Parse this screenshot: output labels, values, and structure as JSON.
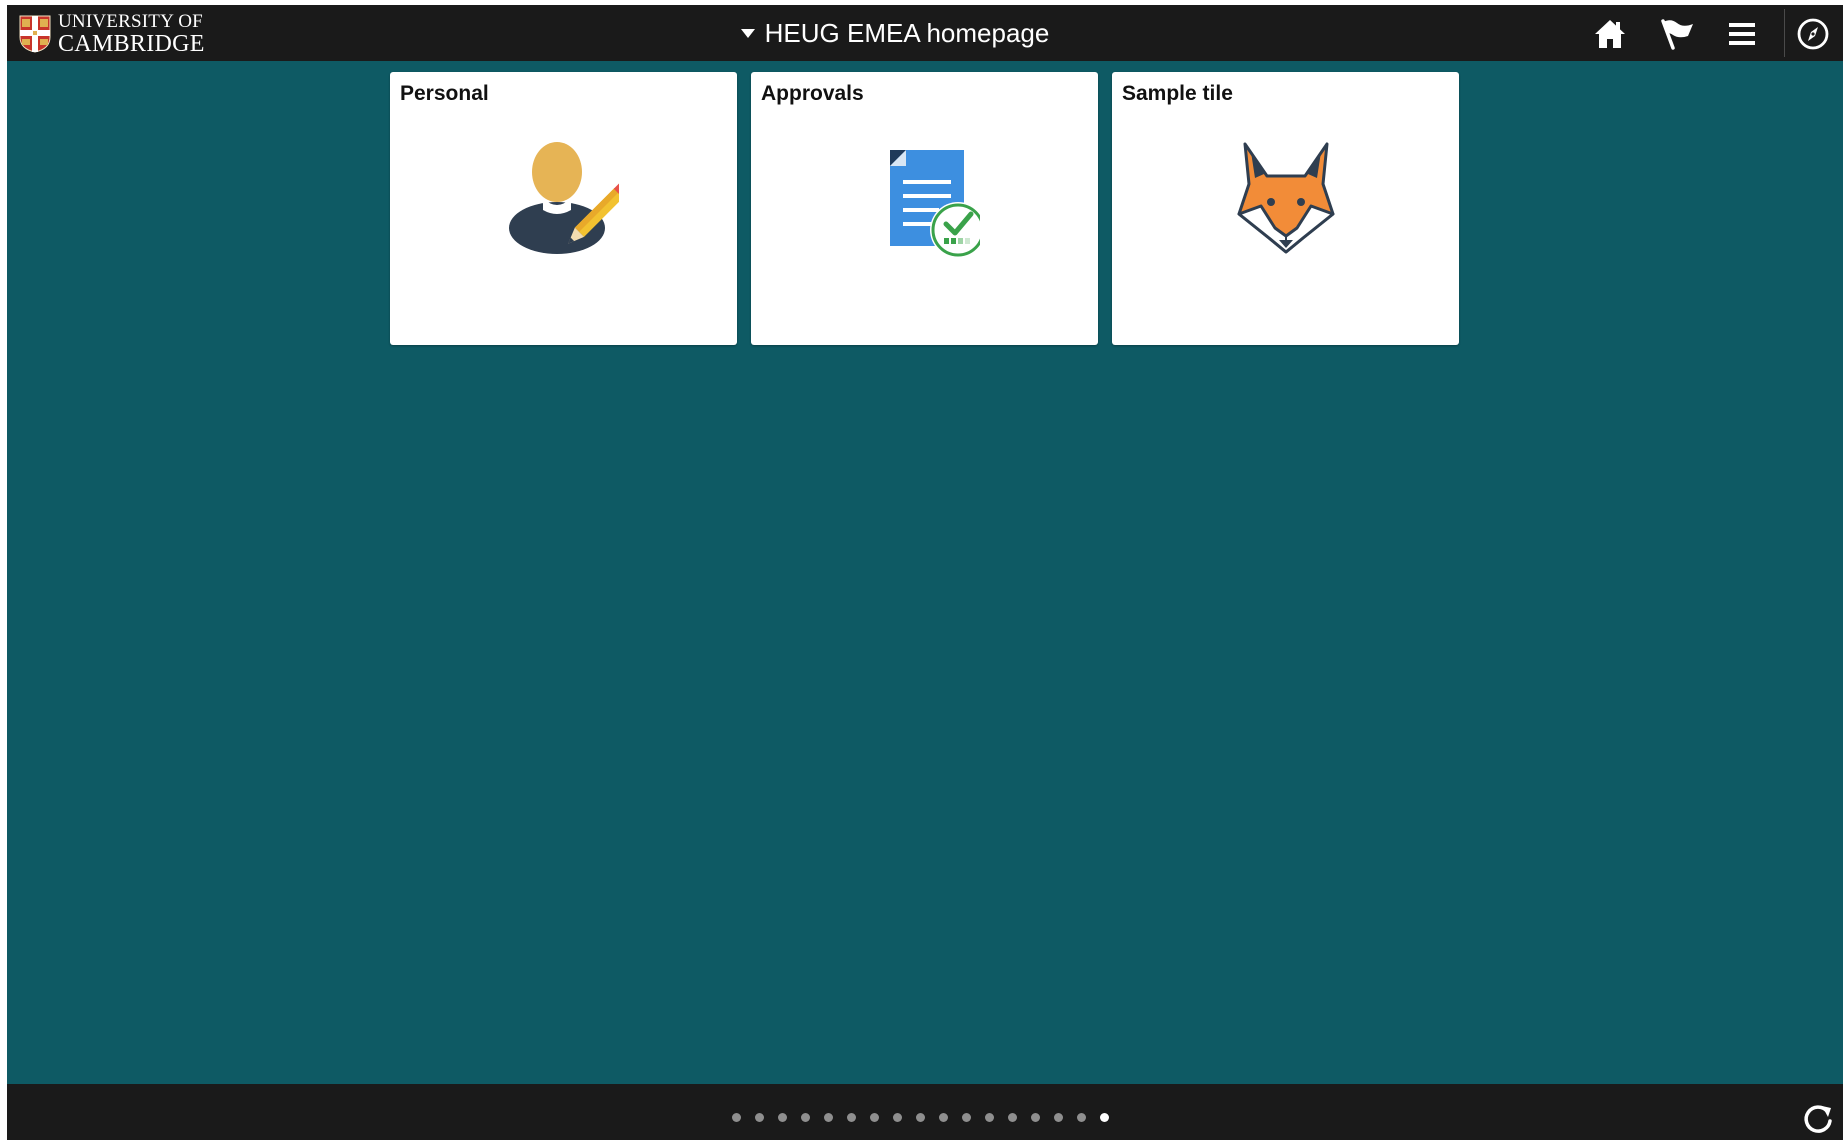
{
  "header": {
    "logo": {
      "line1": "UNIVERSITY OF",
      "line2": "CAMBRIDGE"
    },
    "title": "HEUG EMEA homepage",
    "icons": [
      "home-icon",
      "flag-icon",
      "menu-icon",
      "navbar-compass-icon"
    ]
  },
  "tiles": [
    {
      "title": "Personal",
      "icon": "person-edit-icon"
    },
    {
      "title": "Approvals",
      "icon": "document-check-icon"
    },
    {
      "title": "Sample tile",
      "icon": "fox-icon"
    }
  ],
  "footer": {
    "page_count": 17,
    "active_page": 17,
    "icon": "refresh-icon"
  },
  "colors": {
    "background": "#0e5a64",
    "bar": "#1a1a1a",
    "tile": "#ffffff"
  }
}
